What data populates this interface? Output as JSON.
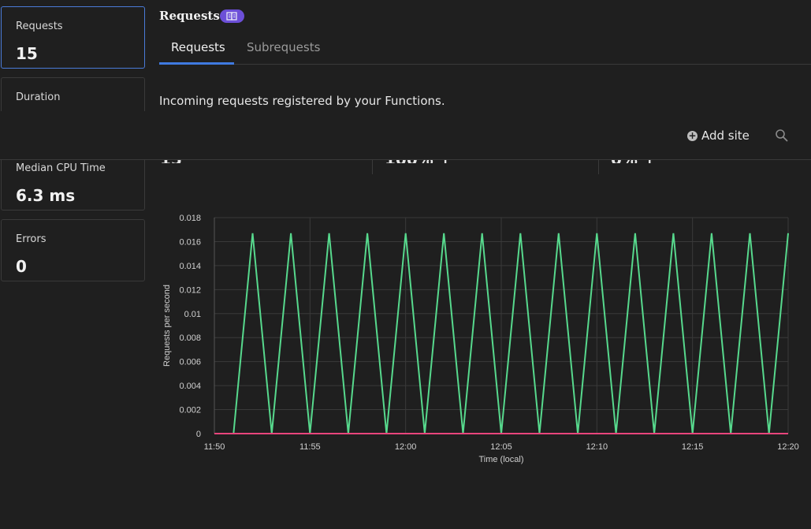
{
  "metrics": [
    {
      "label": "Requests",
      "value": "15"
    },
    {
      "label": "Duration",
      "value": ""
    },
    {
      "label": "Median CPU Time",
      "value": "6.3 ms"
    },
    {
      "label": "Errors",
      "value": "0"
    }
  ],
  "header": {
    "title": "Requests",
    "badge_icon": "book-icon"
  },
  "tabs": [
    {
      "label": "Requests"
    },
    {
      "label": "Subrequests"
    }
  ],
  "description": "Incoming requests registered by your Functions.",
  "toolbar": {
    "add_site_label": "Add site",
    "add_icon": "plus-circle-icon",
    "search_icon": "search-icon"
  },
  "colors": {
    "accent": "#3f7ae0",
    "series_green": "#57d98d",
    "series_pink": "#e8457c",
    "badge": "#6c4fd8"
  },
  "chart_data": {
    "type": "line",
    "xlabel": "Time (local)",
    "ylabel": "Requests per second",
    "ylim": [
      0,
      0.018
    ],
    "yticks": [
      "0.018",
      "0.016",
      "0.014",
      "0.012",
      "0.01",
      "0.008",
      "0.006",
      "0.004",
      "0.002",
      "0"
    ],
    "xticks": [
      "11:50",
      "11:55",
      "12:00",
      "12:05",
      "12:10",
      "12:15",
      "12:20"
    ],
    "grid": true,
    "series": [
      {
        "x": [
          "11:51",
          "11:52",
          "11:53",
          "11:54",
          "11:55",
          "11:56",
          "11:57",
          "11:58",
          "11:59",
          "12:00",
          "12:01",
          "12:02",
          "12:03",
          "12:04",
          "12:05",
          "12:06",
          "12:07",
          "12:08",
          "12:09",
          "12:10",
          "12:11",
          "12:12",
          "12:13",
          "12:14",
          "12:15",
          "12:16",
          "12:17",
          "12:18",
          "12:19",
          "12:20"
        ],
        "values": [
          0,
          0.0167,
          0,
          0.0167,
          0,
          0.0167,
          0,
          0.0167,
          0,
          0.0167,
          0,
          0.0167,
          0,
          0.0167,
          0,
          0.0167,
          0,
          0.0167,
          0,
          0.0167,
          0,
          0.0167,
          0,
          0.0167,
          0,
          0.0167,
          0,
          0.0167,
          0,
          0.0167
        ],
        "color": "#57d98d"
      },
      {
        "x": [
          "11:50",
          "12:20"
        ],
        "values": [
          0,
          0
        ],
        "color": "#e8457c"
      }
    ]
  }
}
